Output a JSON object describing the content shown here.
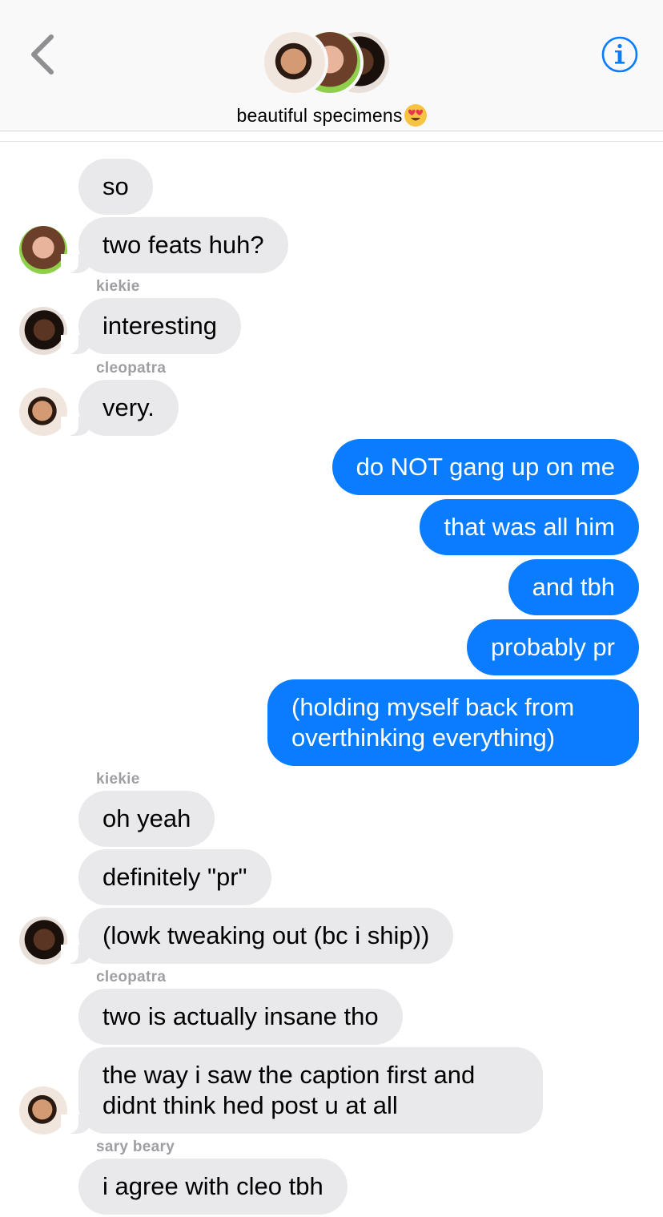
{
  "header": {
    "back_icon": "chevron-left-icon",
    "info_icon": "info-icon",
    "group_name": "beautiful specimens",
    "title_emoji": "heart-eyes-emoji",
    "colors": {
      "accent": "#0a7cff",
      "incoming_bubble": "#e9e9eb",
      "sender_label": "#9e9ea3"
    }
  },
  "messages": [
    {
      "from": "sary beary",
      "text": "so"
    },
    {
      "from": "sary beary",
      "text": "two feats huh?"
    },
    {
      "sender_label": "kiekie"
    },
    {
      "from": "kiekie",
      "text": "interesting"
    },
    {
      "sender_label": "cleopatra"
    },
    {
      "from": "cleopatra",
      "text": "very."
    },
    {
      "from": "me",
      "text": "do NOT gang up on me"
    },
    {
      "from": "me",
      "text": "that was all him"
    },
    {
      "from": "me",
      "text": "and tbh"
    },
    {
      "from": "me",
      "text": "probably pr"
    },
    {
      "from": "me",
      "text": "(holding myself back from overthinking everything)"
    },
    {
      "sender_label": "kiekie"
    },
    {
      "from": "kiekie",
      "text": "oh yeah"
    },
    {
      "from": "kiekie",
      "text": "definitely \"pr\""
    },
    {
      "from": "kiekie",
      "text": "(lowk tweaking out (bc i ship))"
    },
    {
      "sender_label": "cleopatra"
    },
    {
      "from": "cleopatra",
      "text": "two is actually insane tho"
    },
    {
      "from": "cleopatra",
      "text": "the way i saw the caption first and didnt think hed post u at all"
    },
    {
      "sender_label": "sary beary"
    },
    {
      "from": "sary beary",
      "text": "i agree with cleo tbh"
    }
  ]
}
